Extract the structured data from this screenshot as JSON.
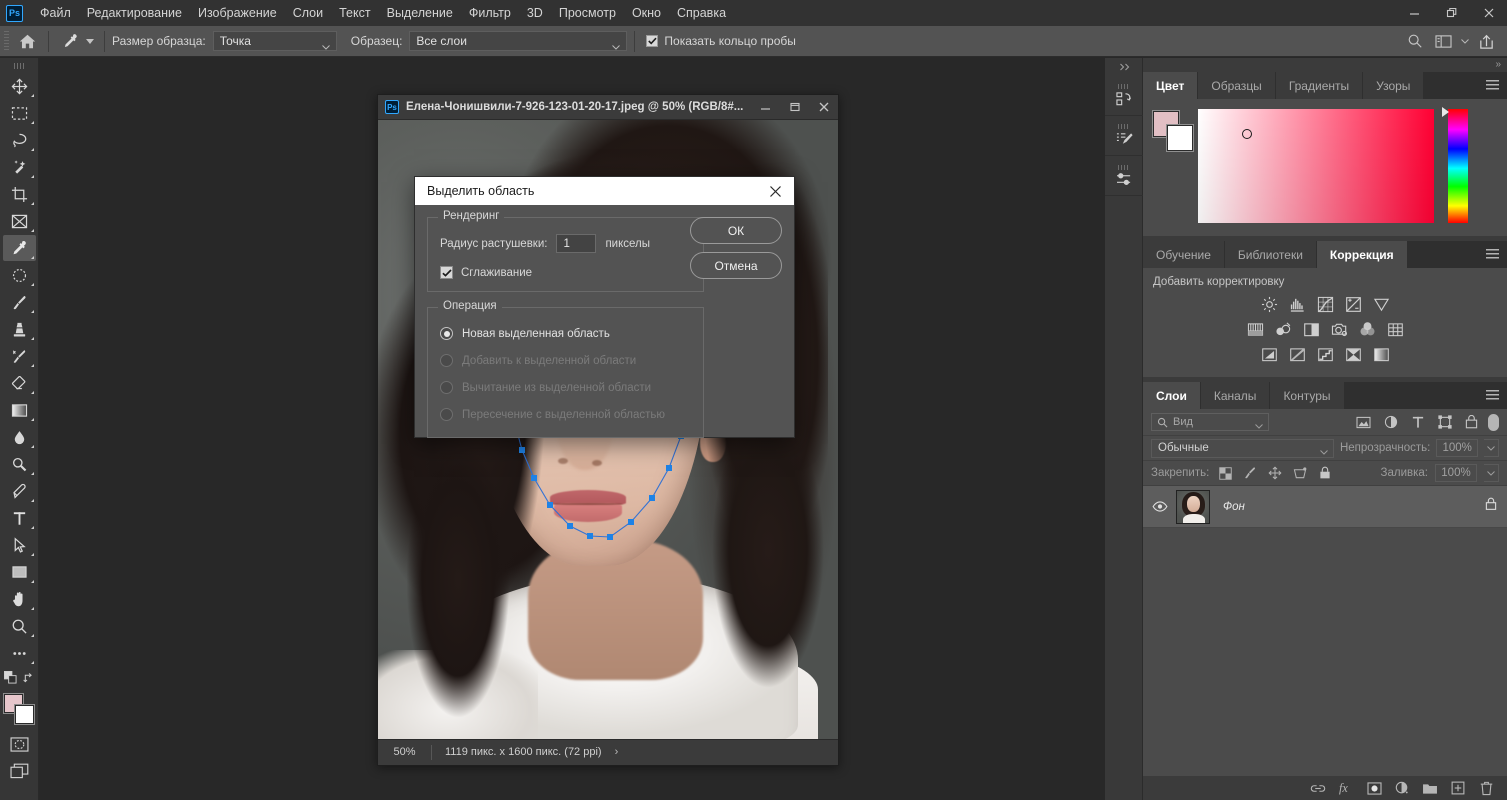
{
  "app": {
    "logo": "Ps",
    "window_controls": [
      "minimize",
      "restore",
      "close"
    ]
  },
  "menubar": {
    "items": [
      {
        "label": "Файл",
        "name": "menu-file"
      },
      {
        "label": "Редактирование",
        "name": "menu-edit"
      },
      {
        "label": "Изображение",
        "name": "menu-image"
      },
      {
        "label": "Слои",
        "name": "menu-layers"
      },
      {
        "label": "Текст",
        "name": "menu-type"
      },
      {
        "label": "Выделение",
        "name": "menu-select"
      },
      {
        "label": "Фильтр",
        "name": "menu-filter"
      },
      {
        "label": "3D",
        "name": "menu-3d"
      },
      {
        "label": "Просмотр",
        "name": "menu-view"
      },
      {
        "label": "Окно",
        "name": "menu-window"
      },
      {
        "label": "Справка",
        "name": "menu-help"
      }
    ]
  },
  "options_bar": {
    "home_icon": "home-icon",
    "tool_icon": "eyedropper-icon",
    "sample_size_label": "Размер образца:",
    "sample_size_value": "Точка",
    "sample_label": "Образец:",
    "sample_value": "Все слои",
    "show_ring_label": "Показать кольцо пробы",
    "show_ring_checked": true,
    "right_icons": [
      "search-icon",
      "workspace-icon",
      "share-icon"
    ]
  },
  "toolbar": {
    "tools": [
      {
        "name": "move-tool",
        "icon": "move"
      },
      {
        "name": "rectangular-marquee-tool",
        "icon": "marquee"
      },
      {
        "name": "lasso-tool",
        "icon": "lasso"
      },
      {
        "name": "quick-selection-tool",
        "icon": "magicwand"
      },
      {
        "name": "crop-tool",
        "icon": "crop"
      },
      {
        "name": "frame-tool",
        "icon": "frame"
      },
      {
        "name": "eyedropper-tool",
        "icon": "eyedropper",
        "active": true
      },
      {
        "name": "spot-healing-brush-tool",
        "icon": "healing"
      },
      {
        "name": "brush-tool",
        "icon": "brush"
      },
      {
        "name": "clone-stamp-tool",
        "icon": "stamp"
      },
      {
        "name": "history-brush-tool",
        "icon": "historybrush"
      },
      {
        "name": "eraser-tool",
        "icon": "eraser"
      },
      {
        "name": "gradient-tool",
        "icon": "gradient"
      },
      {
        "name": "blur-tool",
        "icon": "blur"
      },
      {
        "name": "dodge-tool",
        "icon": "dodge"
      },
      {
        "name": "pen-tool",
        "icon": "pen"
      },
      {
        "name": "type-tool",
        "icon": "type"
      },
      {
        "name": "path-selection-tool",
        "icon": "pathselect"
      },
      {
        "name": "rectangle-tool",
        "icon": "rectangle"
      },
      {
        "name": "hand-tool",
        "icon": "hand"
      },
      {
        "name": "zoom-tool",
        "icon": "zoom"
      },
      {
        "name": "edit-toolbar-button",
        "icon": "ellipsis"
      }
    ],
    "foreground_color": "#e7c7cc",
    "background_color": "#ffffff",
    "quickmask_icon": "quickmask-icon",
    "screenmode_icon": "screenmode-icon"
  },
  "document": {
    "title": "Елена-Чонишвили-7-926-123-01-20-17.jpeg @ 50% (RGB/8#...",
    "zoom": "50%",
    "dimensions": "1119 пикс. x 1600 пикс. (72 ppi)",
    "status_arrow": "›",
    "window_controls": [
      "minimize",
      "restore",
      "close"
    ],
    "selection_color": "#1e7fe0"
  },
  "dialog": {
    "title": "Выделить область",
    "close_icon": "close-icon",
    "rendering": {
      "legend": "Рендеринг",
      "feather_label": "Радиус растушевки:",
      "feather_value": "1",
      "feather_units": "пикселы",
      "antialias_label": "Сглаживание",
      "antialias_checked": true
    },
    "operation": {
      "legend": "Операция",
      "options": [
        {
          "label": "Новая выделенная область",
          "selected": true,
          "disabled": false
        },
        {
          "label": "Добавить к выделенной области",
          "selected": false,
          "disabled": true
        },
        {
          "label": "Вычитание из выделенной области",
          "selected": false,
          "disabled": true
        },
        {
          "label": "Пересечение с выделенной областью",
          "selected": false,
          "disabled": true
        }
      ]
    },
    "buttons": {
      "ok": "ОК",
      "cancel": "Отмена"
    }
  },
  "right_dock": {
    "rail_icons": [
      "history-icon",
      "brush-presets-icon",
      "tool-presets-icon"
    ],
    "collapse_icon": "chevrons-right-icon",
    "color_panel": {
      "tabs": [
        {
          "label": "Цвет",
          "selected": true
        },
        {
          "label": "Образцы",
          "selected": false
        },
        {
          "label": "Градиенты",
          "selected": false
        },
        {
          "label": "Узоры",
          "selected": false
        }
      ],
      "menu_icon": "panel-menu-icon",
      "foreground_color": "#e2bfc4",
      "background_color": "#ffffff"
    },
    "adjustments_panel": {
      "tabs": [
        {
          "label": "Обучение",
          "selected": false
        },
        {
          "label": "Библиотеки",
          "selected": false
        },
        {
          "label": "Коррекция",
          "selected": true
        }
      ],
      "menu_icon": "panel-menu-icon",
      "add_label": "Добавить корректировку",
      "icons_row1": [
        "brightness-contrast-icon",
        "levels-icon",
        "curves-icon",
        "exposure-icon",
        "vibrance-icon"
      ],
      "icons_row2": [
        "hue-saturation-icon",
        "color-balance-icon",
        "black-white-icon",
        "photo-filter-icon",
        "channel-mixer-icon",
        "color-lookup-icon"
      ],
      "icons_row3": [
        "invert-icon",
        "posterize-icon",
        "threshold-icon",
        "selective-color-icon",
        "gradient-map-icon"
      ]
    },
    "layers_panel": {
      "tabs": [
        {
          "label": "Слои",
          "selected": true
        },
        {
          "label": "Каналы",
          "selected": false
        },
        {
          "label": "Контуры",
          "selected": false
        }
      ],
      "menu_icon": "panel-menu-icon",
      "filter_placeholder": "Вид",
      "filter_icons": [
        "filter-pixel-icon",
        "filter-adjustment-icon",
        "filter-type-icon",
        "filter-shape-icon",
        "filter-smart-icon"
      ],
      "filter_toggle": "filter-enable-toggle",
      "blend_mode": "Обычные",
      "opacity_label": "Непрозрачность:",
      "opacity_value": "100%",
      "lock_label": "Закрепить:",
      "lock_icons": [
        "lock-transparent-icon",
        "lock-image-icon",
        "lock-position-icon",
        "lock-artboard-icon",
        "lock-all-icon"
      ],
      "fill_label": "Заливка:",
      "fill_value": "100%",
      "layers": [
        {
          "name": "Фон",
          "visible": true,
          "locked": true
        }
      ],
      "footer_icons": [
        "link-layers-icon",
        "layer-style-icon",
        "layer-mask-icon",
        "adjustment-layer-icon",
        "new-group-icon",
        "new-layer-icon",
        "delete-layer-icon"
      ]
    }
  }
}
